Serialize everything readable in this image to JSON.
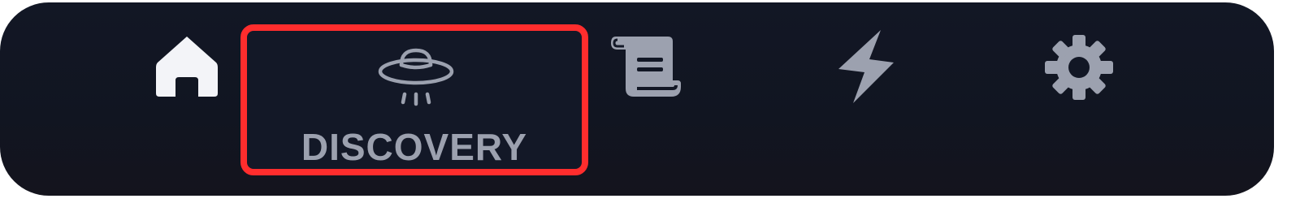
{
  "nav": {
    "items": [
      {
        "id": "home",
        "icon": "home-icon",
        "label": "",
        "active_color": "#f3f4f8"
      },
      {
        "id": "discovery",
        "icon": "ufo-icon",
        "label": "DISCOVERY",
        "highlighted": true
      },
      {
        "id": "logs",
        "icon": "scroll-icon",
        "label": ""
      },
      {
        "id": "activity",
        "icon": "lightning-icon",
        "label": ""
      },
      {
        "id": "settings",
        "icon": "gear-icon",
        "label": ""
      }
    ],
    "highlight_color": "#ff2d2d",
    "icon_color": "#9ca1af",
    "background_color": "#121725"
  }
}
